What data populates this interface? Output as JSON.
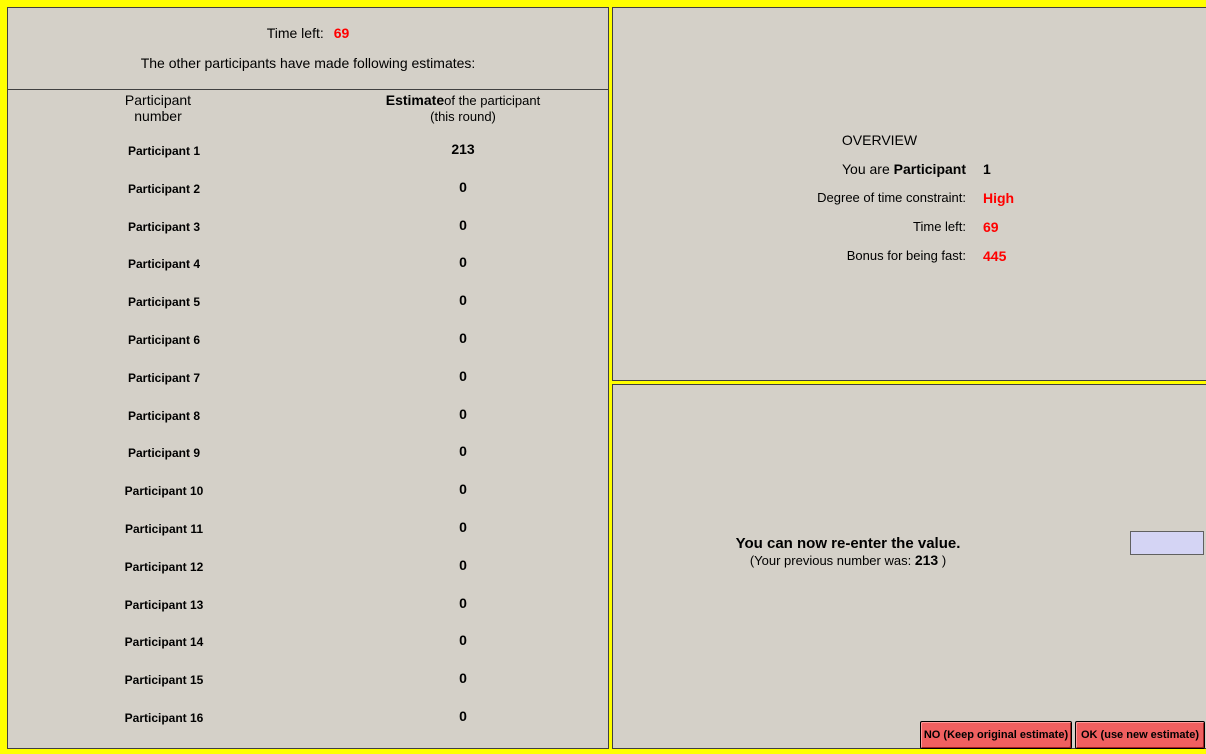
{
  "left": {
    "time_left_label": "Time left:",
    "time_left_value": "69",
    "heading": "The other participants have made following estimates:",
    "col_participant_line1": "Participant",
    "col_participant_line2": "number",
    "col_estimate_bold": "Estimate",
    "col_estimate_rest": "of the participant",
    "col_estimate_line2": "(this round)",
    "rows": [
      {
        "label": "Participant 1",
        "value": "213"
      },
      {
        "label": "Participant 2",
        "value": "0"
      },
      {
        "label": "Participant 3",
        "value": "0"
      },
      {
        "label": "Participant 4",
        "value": "0"
      },
      {
        "label": "Participant 5",
        "value": "0"
      },
      {
        "label": "Participant 6",
        "value": "0"
      },
      {
        "label": "Participant 7",
        "value": "0"
      },
      {
        "label": "Participant 8",
        "value": "0"
      },
      {
        "label": "Participant 9",
        "value": "0"
      },
      {
        "label": "Participant 10",
        "value": "0"
      },
      {
        "label": "Participant 11",
        "value": "0"
      },
      {
        "label": "Participant 12",
        "value": "0"
      },
      {
        "label": "Participant 13",
        "value": "0"
      },
      {
        "label": "Participant 14",
        "value": "0"
      },
      {
        "label": "Participant 15",
        "value": "0"
      },
      {
        "label": "Participant 16",
        "value": "0"
      }
    ]
  },
  "overview": {
    "title": "OVERVIEW",
    "you_are_label": "You are",
    "you_are_bold": "Participant",
    "you_are_value": "1",
    "constraint_label": "Degree of time constraint:",
    "constraint_value": "High",
    "time_left_label": "Time left:",
    "time_left_value": "69",
    "bonus_label": "Bonus for being fast:",
    "bonus_value": "445"
  },
  "input": {
    "prompt": "You can now re-enter the value.",
    "previous_prefix": "(Your previous number was:",
    "previous_value": "213",
    "previous_suffix": ")",
    "value": ""
  },
  "buttons": {
    "no_label": "NO (Keep original estimate)",
    "ok_label": "OK (use new estimate)"
  },
  "colors": {
    "background": "#ffff00",
    "panel": "#d4d0c8",
    "highlight": "#ff0000",
    "button": "#f06060",
    "input": "#d4d4f4"
  }
}
